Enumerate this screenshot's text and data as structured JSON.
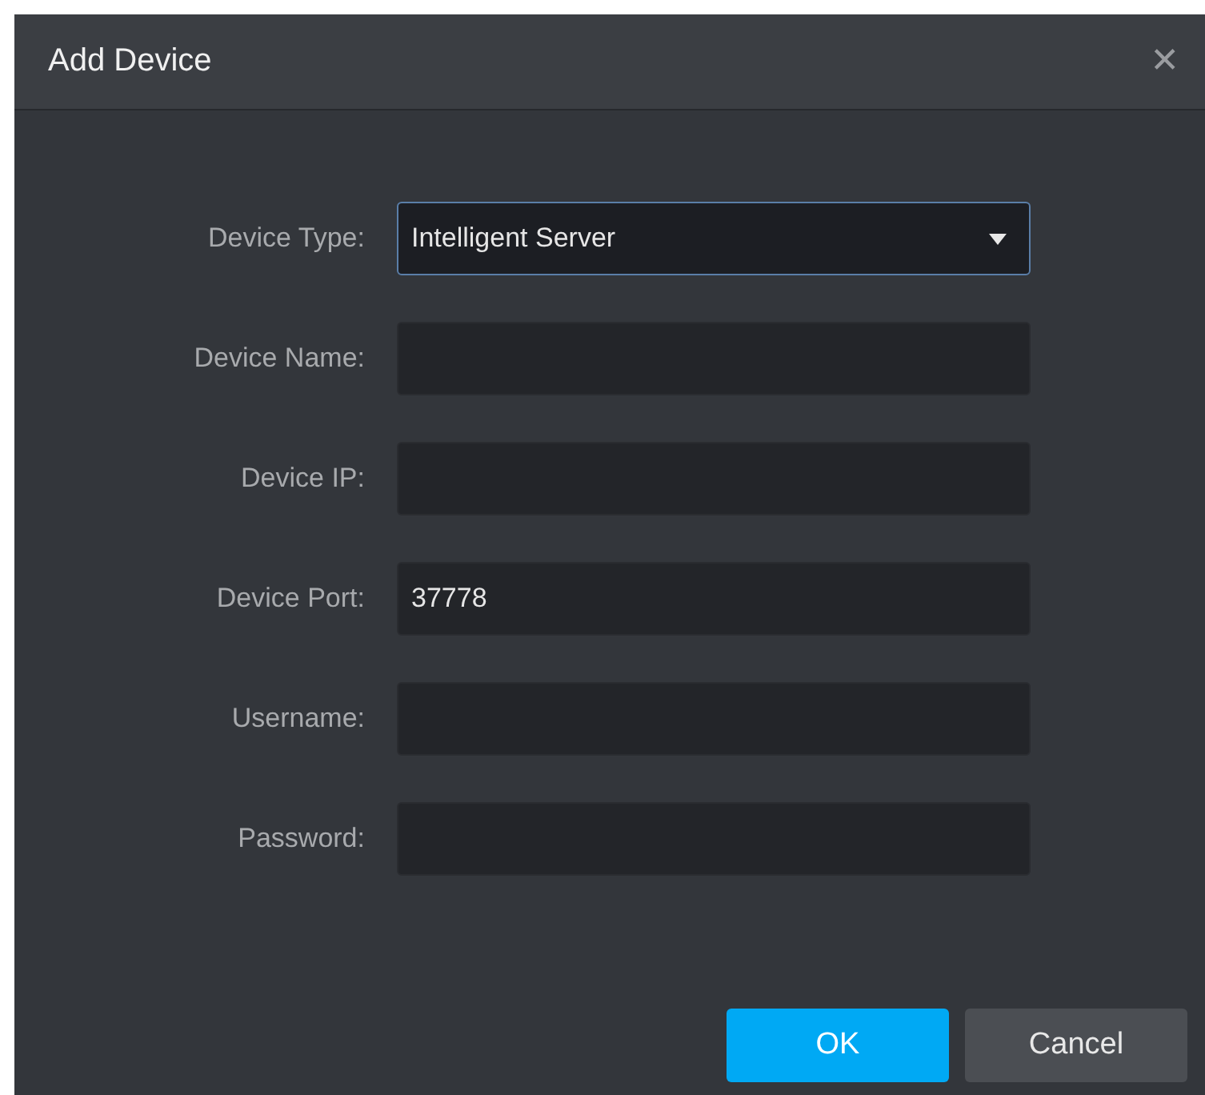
{
  "window": {
    "title": "Add Device",
    "close": "✕"
  },
  "fields": [
    {
      "label": "Device Type:",
      "kind": "select",
      "value": "Intelligent Server",
      "focused": true
    },
    {
      "label": "Device Name:",
      "kind": "text",
      "focused": false
    },
    {
      "label": "Device IP:",
      "kind": "text",
      "focused": false
    },
    {
      "label": "Device Port:",
      "kind": "text",
      "value": "37778",
      "focused": false
    },
    {
      "label": "Username:",
      "kind": "text",
      "focused": false
    },
    {
      "label": "Password:",
      "kind": "password",
      "focused": false
    }
  ],
  "buttons": [
    {
      "label": "OK",
      "kind": "primary"
    },
    {
      "label": "Cancel",
      "kind": "secondary"
    }
  ]
}
